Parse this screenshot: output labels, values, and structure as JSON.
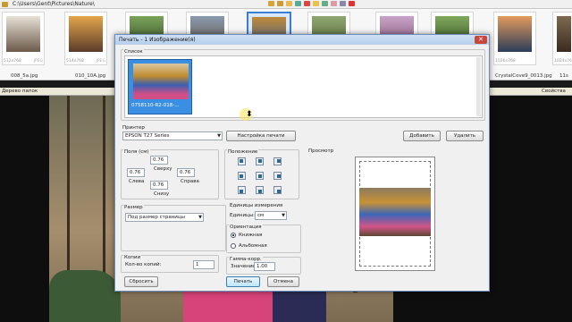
{
  "viewer": {
    "path": "C:\\Users\\Gent\\Pictures\\Nature\\",
    "thumbs": [
      {
        "meta": "512x768",
        "format": "JPEG",
        "name": "008_5a.jpg"
      },
      {
        "meta": "514x768",
        "format": "JPEG",
        "name": "010_10A.jpg"
      },
      {
        "meta": "1026x768",
        "format": "JPEG",
        "name": "CrystalCove9_0013.jpg"
      },
      {
        "meta": "1024x768",
        "format": "",
        "name": "11s"
      }
    ],
    "tree_panel": "Дерево папок",
    "props_panel": "Свойства изо"
  },
  "dialog": {
    "title": "Печать - 1 Изображение(я)",
    "list_label": "Список",
    "list_item": "0758110-R2-018-...",
    "printer_label": "Принтер",
    "printer_value": "EPSON T27 Series",
    "printer_settings": "Настройка печати",
    "add_button": "Добавить",
    "delete_button": "Удалить",
    "margins_label": "Поля (см)",
    "margin_top_label": "Сверху",
    "margin_left_label": "Слева",
    "margin_right_label": "Справа",
    "margin_bottom_label": "Снизу",
    "margin_top": "0.76",
    "margin_left": "0.76",
    "margin_right": "0.76",
    "margin_bottom": "0.76",
    "position_label": "Положение",
    "preview_label": "Просмотр",
    "size_label": "Размер",
    "size_value": "Под размер страницы",
    "units_label": "Единицы измерения",
    "units_field_label": "Единицы:",
    "units_value": "см",
    "orientation_label": "Ориентация",
    "portrait": "Книжная",
    "landscape": "Альбомная",
    "copies_label": "Копии",
    "copies_field_label": "Кол-во копий:",
    "copies_value": "1",
    "gamma_label": "Гамма-корр.",
    "gamma_field_label": "Значение:",
    "gamma_value": "1.00",
    "reset_button": "Сбросить",
    "print_button": "Печать",
    "cancel_button": "Отмена"
  }
}
